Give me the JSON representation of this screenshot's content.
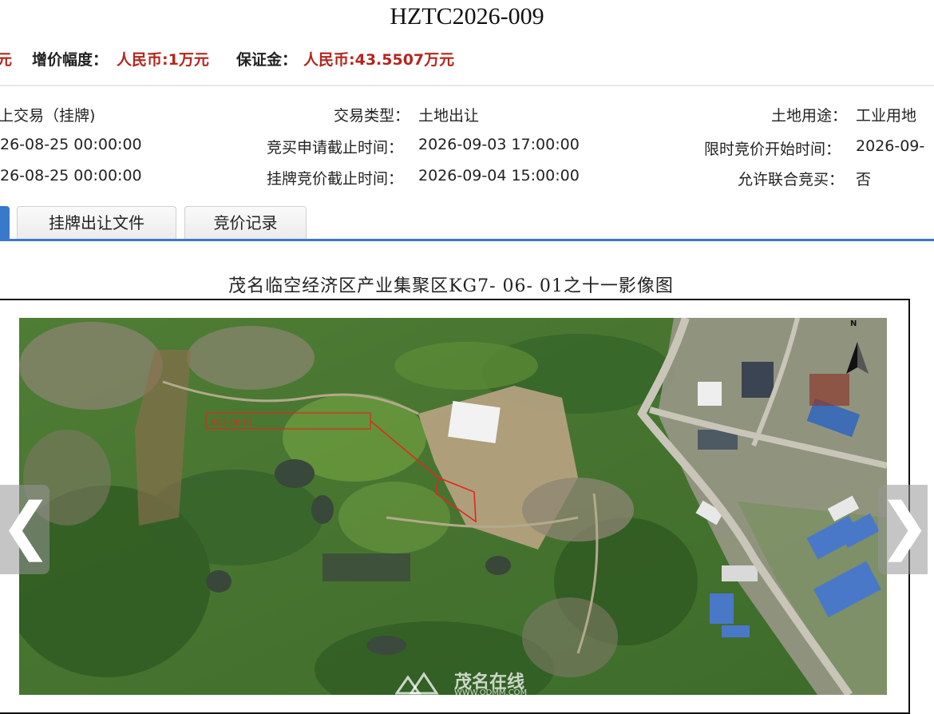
{
  "header": {
    "title": "HZTC2026-009",
    "price_cut": "元",
    "increment_label": "增价幅度：",
    "increment_value": "人民币:1万元",
    "deposit_label": "保证金：",
    "deposit_value": "人民币:43.5507万元"
  },
  "info": {
    "row1": {
      "col1_value": "上交易（挂牌)",
      "col2_label": "交易类型：",
      "col2_value": "土地出让",
      "col3_label": "土地用途：",
      "col3_value": "工业用地"
    },
    "row2": {
      "col1_value": "26-08-25 00:00:00",
      "col2_label": "竞买申请截止时间：",
      "col2_value": "2026-09-03 17:00:00",
      "col3_label": "限时竞价开始时间：",
      "col3_value": "2026-09-"
    },
    "row3": {
      "col1_value": "26-08-25 00:00:00",
      "col2_label": "挂牌竞价截止时间：",
      "col2_value": "2026-09-04 15:00:00",
      "col3_label": "允许联合竞买：",
      "col3_value": "否"
    }
  },
  "tabs": [
    {
      "label": "挂牌出让文件"
    },
    {
      "label": "竞价记录"
    }
  ],
  "map": {
    "title": "茂名临空经济区产业集聚区KG7- 06- 01之十一影像图",
    "north_label": "N"
  },
  "nav": {
    "prev": "❮",
    "next": "❯"
  },
  "watermark": {
    "name": "茂名在线",
    "url": "WWW.ODMM.COM"
  },
  "colors": {
    "accent": "#3a79c9",
    "price_red": "#b3261e"
  }
}
